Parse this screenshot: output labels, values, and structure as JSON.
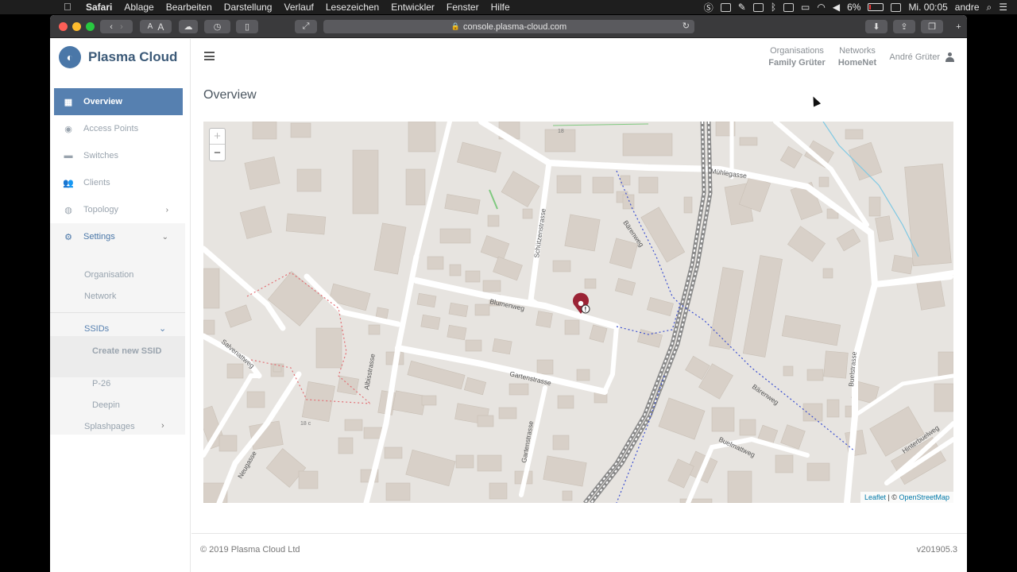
{
  "menubar": {
    "apple": "",
    "app": "Safari",
    "menus": [
      "Ablage",
      "Bearbeiten",
      "Darstellung",
      "Verlauf",
      "Lesezeichen",
      "Entwickler",
      "Fenster",
      "Hilfe"
    ],
    "battery": "6%",
    "clock": "Mi. 00:05",
    "user": "andre"
  },
  "browser": {
    "url": "console.plasma-cloud.com",
    "reader_small": "A",
    "reader_large": "A"
  },
  "sidebar": {
    "brand": "Plasma Cloud",
    "items": [
      {
        "label": "Overview",
        "icon": "table-icon"
      },
      {
        "label": "Access Points",
        "icon": "access-point-icon"
      },
      {
        "label": "Switches",
        "icon": "switch-icon"
      },
      {
        "label": "Clients",
        "icon": "users-icon"
      },
      {
        "label": "Topology",
        "icon": "globe-icon"
      },
      {
        "label": "Settings",
        "icon": "gear-icon"
      }
    ],
    "settings_sub": {
      "organisation": "Organisation",
      "network": "Network",
      "ssids": "SSIDs",
      "create_ssid": "Create new SSID",
      "ssid_list": [
        "P-26",
        "Deepin"
      ],
      "splashpages": "Splashpages"
    }
  },
  "header": {
    "organisations_label": "Organisations",
    "organisation_value": "Family Grüter",
    "networks_label": "Networks",
    "network_value": "HomeNet",
    "user_name": "André Grüter"
  },
  "main": {
    "title": "Overview"
  },
  "map": {
    "zoom_in": "+",
    "zoom_out": "−",
    "streets": [
      "Mühlegasse",
      "Schützenstrasse",
      "Bärenweg",
      "Blumenweg",
      "Gartenstrasse",
      "Albisstrasse",
      "Salvenattweg",
      "Neugasse",
      "Buelmattweg",
      "Bärenweg",
      "Buelstrasse",
      "Hinterbuelweg",
      "Gartenstrasse"
    ],
    "house_numbers": [
      "18",
      "18 c"
    ],
    "attribution_leaflet": "Leaflet",
    "attribution_sep": " | © ",
    "attribution_osm": "OpenStreetMap",
    "marker_color": "#9b2335"
  },
  "footer": {
    "copyright": "© 2019 Plasma Cloud Ltd",
    "version": "v201905.3"
  },
  "colors": {
    "accent": "#5680b0",
    "brand_text": "#3c5a78",
    "map_bg": "#e7e4e0",
    "building": "#d6cfc8"
  }
}
